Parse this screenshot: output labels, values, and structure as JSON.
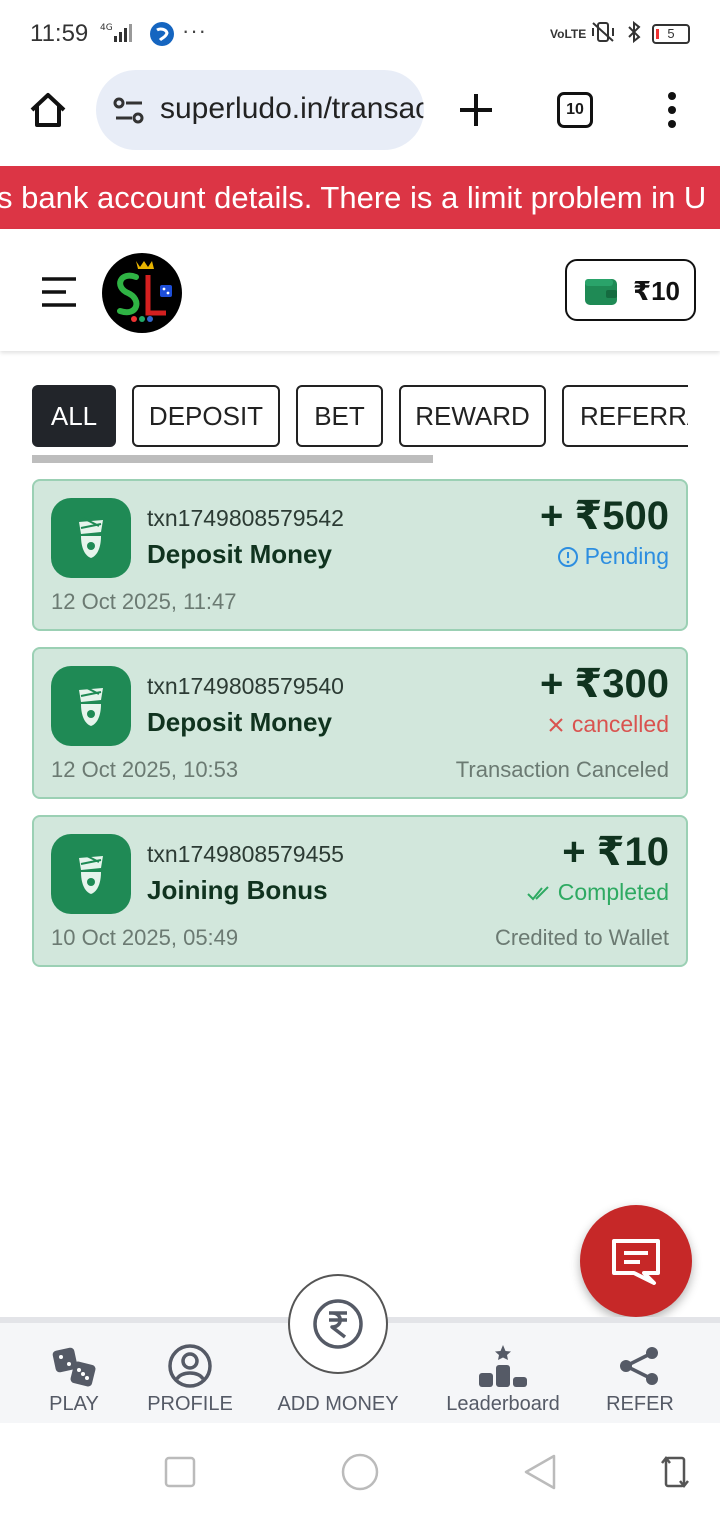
{
  "status_bar": {
    "time": "11:59",
    "network": "4G",
    "more": "···",
    "volte": "VoLTE",
    "battery": "5"
  },
  "browser": {
    "url": "superludo.in/transactions",
    "tab_count": "10"
  },
  "announcement": {
    "text": "s bank account details. There is a limit problem in U"
  },
  "header": {
    "wallet_balance": "₹10"
  },
  "tabs": [
    {
      "label": "ALL",
      "active": true
    },
    {
      "label": "DEPOSIT",
      "active": false
    },
    {
      "label": "BET",
      "active": false
    },
    {
      "label": "REWARD",
      "active": false
    },
    {
      "label": "REFERRAL",
      "active": false
    }
  ],
  "transactions": [
    {
      "txid": "txn1749808579542",
      "title": "Deposit Money",
      "amount": "+ ₹500",
      "status": "Pending",
      "status_icon": "info-icon",
      "date": "12 Oct 2025, 11:47",
      "note": ""
    },
    {
      "txid": "txn1749808579540",
      "title": "Deposit Money",
      "amount": "+ ₹300",
      "status": "cancelled",
      "status_icon": "close-icon",
      "date": "12 Oct 2025, 10:53",
      "note": "Transaction Canceled"
    },
    {
      "txid": "txn1749808579455",
      "title": "Joining Bonus",
      "amount": "+ ₹10",
      "status": "Completed",
      "status_icon": "double-check-icon",
      "date": "10 Oct 2025, 05:49",
      "note": "Credited to Wallet"
    }
  ],
  "bottom_nav": {
    "play": "PLAY",
    "profile": "PROFILE",
    "add_money": "ADD MONEY",
    "leaderboard": "Leaderboard",
    "refer": "REFER"
  },
  "colors": {
    "announcement_bg": "#dc3545",
    "card_bg": "#d2e7dc",
    "card_border": "#9bd0b4",
    "icon_green": "#1f8a55",
    "pending": "#2d8ee0",
    "cancelled": "#d9534f",
    "completed": "#2eaa62",
    "chat_fab": "#c62828"
  }
}
